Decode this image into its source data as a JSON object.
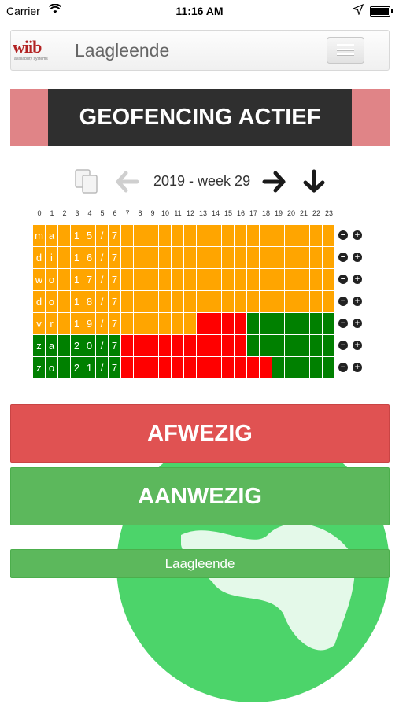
{
  "status_bar": {
    "carrier": "Carrier",
    "time": "11:16 AM"
  },
  "navbar": {
    "logo_text": "wiib",
    "logo_tagline": "availability systems",
    "brand": "Laagleende"
  },
  "geofence": {
    "label": "GEOFENCING ACTIEF",
    "color": "#2f2f2f",
    "side_color": "#e08487"
  },
  "week_nav": {
    "label": "2019 - week 29"
  },
  "schedule": {
    "hours": [
      "0",
      "1",
      "2",
      "3",
      "4",
      "5",
      "6",
      "7",
      "8",
      "9",
      "10",
      "11",
      "12",
      "13",
      "14",
      "15",
      "16",
      "17",
      "18",
      "19",
      "20",
      "21",
      "22",
      "23"
    ],
    "legend_colors": {
      "o": "#ffa500",
      "r": "#ff0000",
      "g": "#008000"
    },
    "rows": [
      {
        "labels": [
          "m",
          "a",
          "",
          "1",
          "5",
          "/",
          "7"
        ],
        "cells": "oooooooooooooooooooooooo"
      },
      {
        "labels": [
          "d",
          "i",
          "",
          "1",
          "6",
          "/",
          "7"
        ],
        "cells": "oooooooooooooooooooooooo"
      },
      {
        "labels": [
          "w",
          "o",
          "",
          "1",
          "7",
          "/",
          "7"
        ],
        "cells": "oooooooooooooooooooooooo"
      },
      {
        "labels": [
          "d",
          "o",
          "",
          "1",
          "8",
          "/",
          "7"
        ],
        "cells": "oooooooooooooooooooooooo"
      },
      {
        "labels": [
          "v",
          "r",
          "",
          "1",
          "9",
          "/",
          "7"
        ],
        "cells": "oooooooooooooRRRRggggggg"
      },
      {
        "labels": [
          "z",
          "a",
          "",
          "2",
          "0",
          "/",
          "7"
        ],
        "cells": "gggggggRRRRRRRRRRggggggg"
      },
      {
        "labels": [
          "z",
          "o",
          "",
          "2",
          "1",
          "/",
          "7"
        ],
        "cells": "gggggggRRRRRRRRRRRRggggg"
      }
    ],
    "minus_symbol": "−",
    "plus_symbol": "+"
  },
  "buttons": {
    "afwezig": "AFWEZIG",
    "aanwezig": "AANWEZIG",
    "location": "Laagleende"
  }
}
